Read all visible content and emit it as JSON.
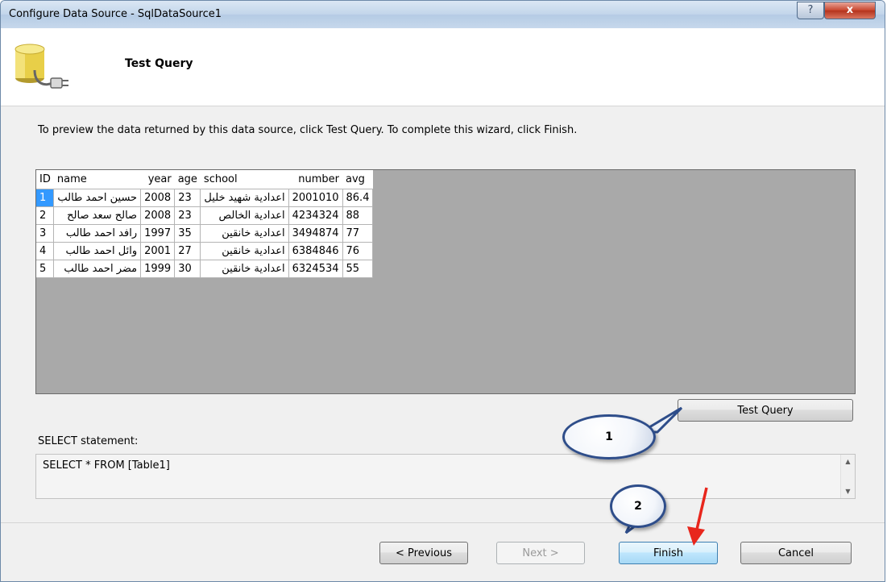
{
  "window": {
    "title": "Configure Data Source - SqlDataSource1",
    "help_glyph": "?",
    "close_glyph": "x"
  },
  "header": {
    "title": "Test Query"
  },
  "instruction": "To preview the data returned by this data source, click Test Query. To complete this wizard, click Finish.",
  "grid": {
    "columns": [
      "ID",
      "name",
      "year",
      "age",
      "school",
      "number",
      "avg"
    ],
    "rows": [
      [
        "1",
        "حسين احمد طالب",
        "2008",
        "23",
        "اعدادية شهيد خليل",
        "2001010",
        "86.4"
      ],
      [
        "2",
        "صالح سعد صالح",
        "2008",
        "23",
        "اعدادية الخالص",
        "4234324",
        "88"
      ],
      [
        "3",
        "رافد احمد طالب",
        "1997",
        "35",
        "اعدادية خانقين",
        "3494874",
        "77"
      ],
      [
        "4",
        "وائل احمد طالب",
        "2001",
        "27",
        "اعدادية خانقين",
        "6384846",
        "76"
      ],
      [
        "5",
        "مضر احمد طالب",
        "1999",
        "30",
        "اعدادية خانقين",
        "6324534",
        "55"
      ]
    ],
    "selected_row": 1
  },
  "buttons": {
    "test_query": "Test Query",
    "previous": "< Previous",
    "next": "Next >",
    "finish": "Finish",
    "cancel": "Cancel"
  },
  "select_statement": {
    "label": "SELECT statement:",
    "value": "SELECT * FROM [Table1]"
  },
  "annotations": {
    "callout_1": "1",
    "callout_2": "2"
  },
  "colors": {
    "selection": "#3399ff",
    "grid_background": "#a9a9a9",
    "callout_border": "#2e4d8a",
    "arrow": "#e8261c"
  }
}
